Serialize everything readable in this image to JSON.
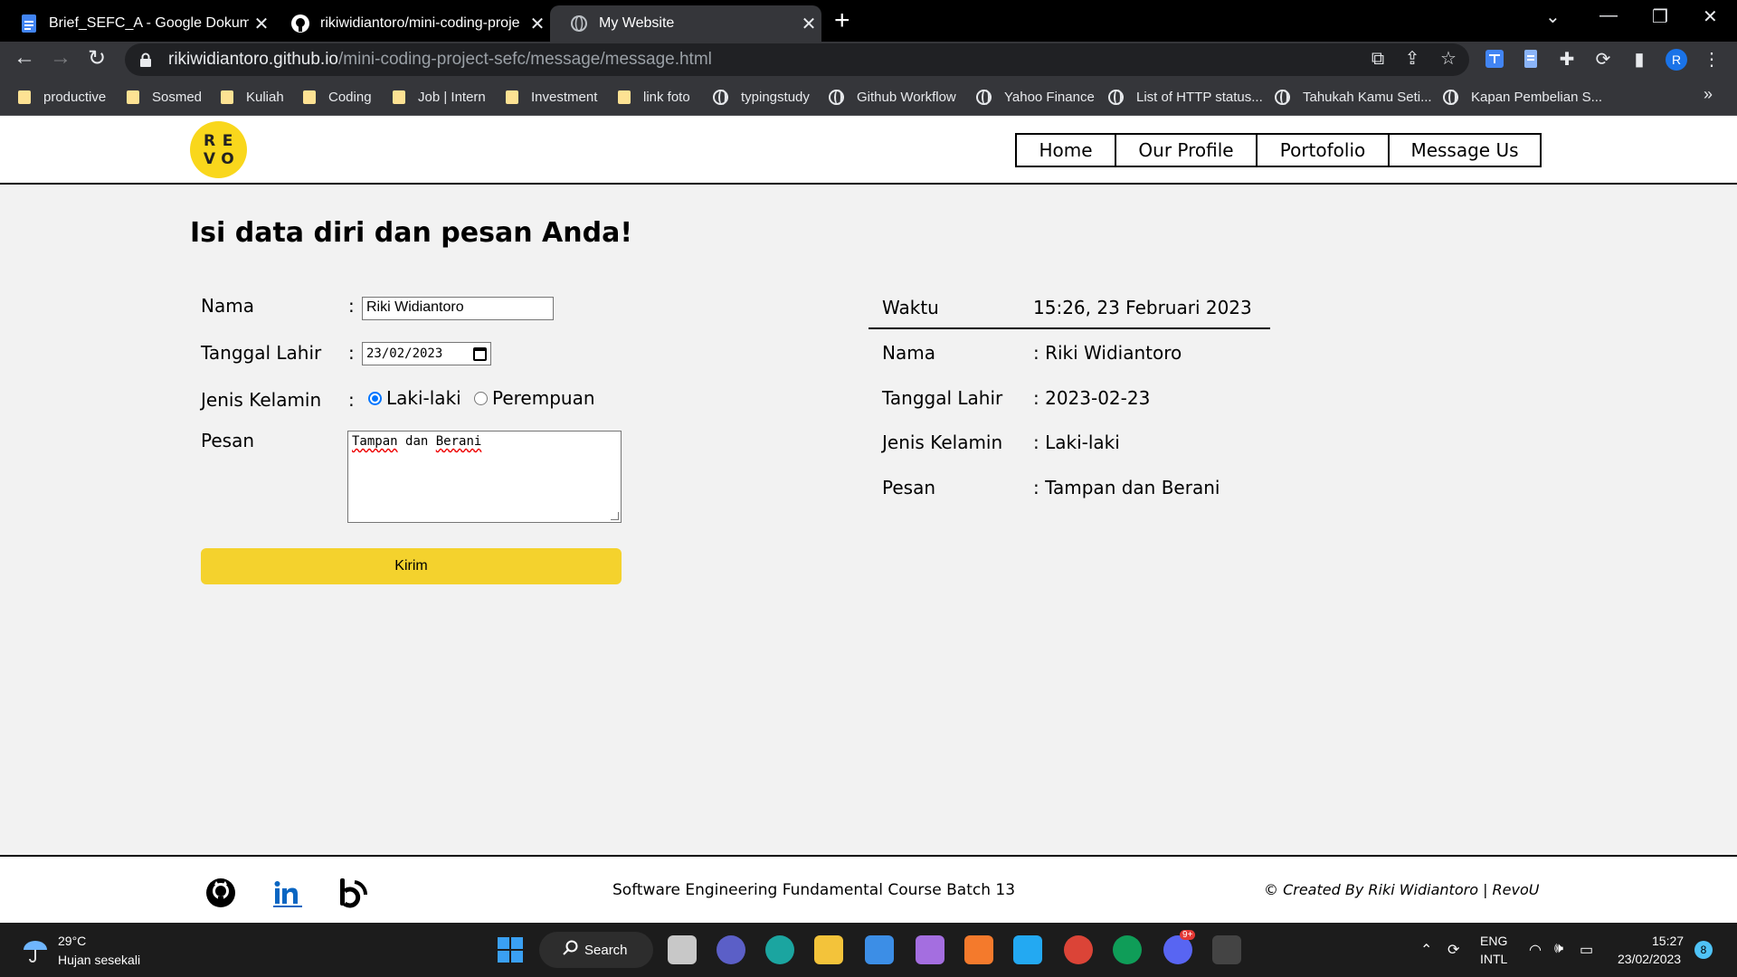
{
  "browser": {
    "tabs": [
      {
        "title": "Brief_SEFC_A - Google Dokumen",
        "icon": "google-docs-icon"
      },
      {
        "title": "rikiwidiantoro/mini-coding-proje",
        "icon": "github-icon"
      },
      {
        "title": "My Website",
        "icon": "globe-icon",
        "active": true
      }
    ],
    "url_host": "rikiwidiantoro.github.io",
    "url_path": "/mini-coding-project-sefc/message/message.html",
    "profile_initial": "R",
    "bookmarks": [
      {
        "label": "productive",
        "type": "folder"
      },
      {
        "label": "Sosmed",
        "type": "folder"
      },
      {
        "label": "Kuliah",
        "type": "folder"
      },
      {
        "label": "Coding",
        "type": "folder"
      },
      {
        "label": "Job | Intern",
        "type": "folder"
      },
      {
        "label": "Investment",
        "type": "folder"
      },
      {
        "label": "link foto",
        "type": "folder"
      },
      {
        "label": "typingstudy",
        "type": "link"
      },
      {
        "label": "Github Workflow",
        "type": "link"
      },
      {
        "label": "Yahoo Finance",
        "type": "link"
      },
      {
        "label": "List of HTTP status...",
        "type": "link"
      },
      {
        "label": "Tahukah Kamu Seti...",
        "type": "link"
      },
      {
        "label": "Kapan Pembelian S...",
        "type": "link"
      }
    ]
  },
  "site": {
    "logo_letters": [
      "R",
      "E",
      "V",
      "O"
    ],
    "nav": [
      "Home",
      "Our Profile",
      "Portofolio",
      "Message Us"
    ],
    "title": "Isi data diri dan pesan Anda!",
    "form": {
      "labels": {
        "name": "Nama",
        "dob": "Tanggal Lahir",
        "gender": "Jenis Kelamin",
        "message": "Pesan"
      },
      "colon": ":",
      "name_value": "Riki Widiantoro",
      "dob_value": "23/02/2023",
      "gender_options": [
        "Laki-laki",
        "Perempuan"
      ],
      "gender_selected": "Laki-laki",
      "message_words": [
        "Tampan",
        "dan",
        "Berani"
      ],
      "submit_label": "Kirim"
    },
    "result": {
      "time_label": "Waktu",
      "time_value": "15:26, 23 Februari 2023",
      "rows": [
        {
          "label": "Nama",
          "value": ": Riki Widiantoro"
        },
        {
          "label": "Tanggal Lahir",
          "value": ": 2023-02-23"
        },
        {
          "label": "Jenis Kelamin",
          "value": ": Laki-laki"
        },
        {
          "label": "Pesan",
          "value": ": Tampan dan Berani"
        }
      ]
    },
    "footer": {
      "course": "Software Engineering Fundamental Course Batch 13",
      "credit": "© Created By Riki Widiantoro | RevoU"
    }
  },
  "taskbar": {
    "temperature": "29°C",
    "weather": "Hujan sesekali",
    "search_label": "Search",
    "discord_badge": "9+",
    "language": "ENG",
    "layout": "INTL",
    "time": "15:27",
    "date": "23/02/2023",
    "notifications": "8"
  }
}
